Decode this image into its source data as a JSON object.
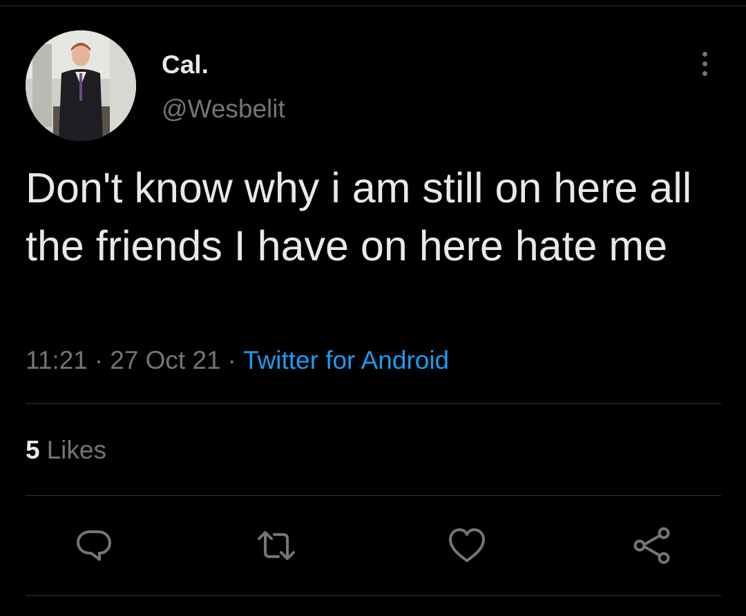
{
  "author": {
    "display_name": "Cal.",
    "handle": "@Wesbelit",
    "avatar_icon": "profile-photo"
  },
  "tweet": {
    "text": "Don't know why i am still on here all the friends I have on here hate me",
    "time": "11:21",
    "separator": "·",
    "date": "27 Oct 21",
    "source": "Twitter for Android"
  },
  "stats": {
    "likes_count": "5",
    "likes_label": "Likes"
  },
  "actions": {
    "reply_icon": "reply-icon",
    "retweet_icon": "retweet-icon",
    "like_icon": "heart-icon",
    "share_icon": "share-icon",
    "more_icon": "more-vertical-icon"
  },
  "colors": {
    "background": "#000000",
    "text_primary": "#e7e9ea",
    "text_secondary": "#71767b",
    "accent": "#1d9bf0",
    "divider": "#2f3336"
  }
}
